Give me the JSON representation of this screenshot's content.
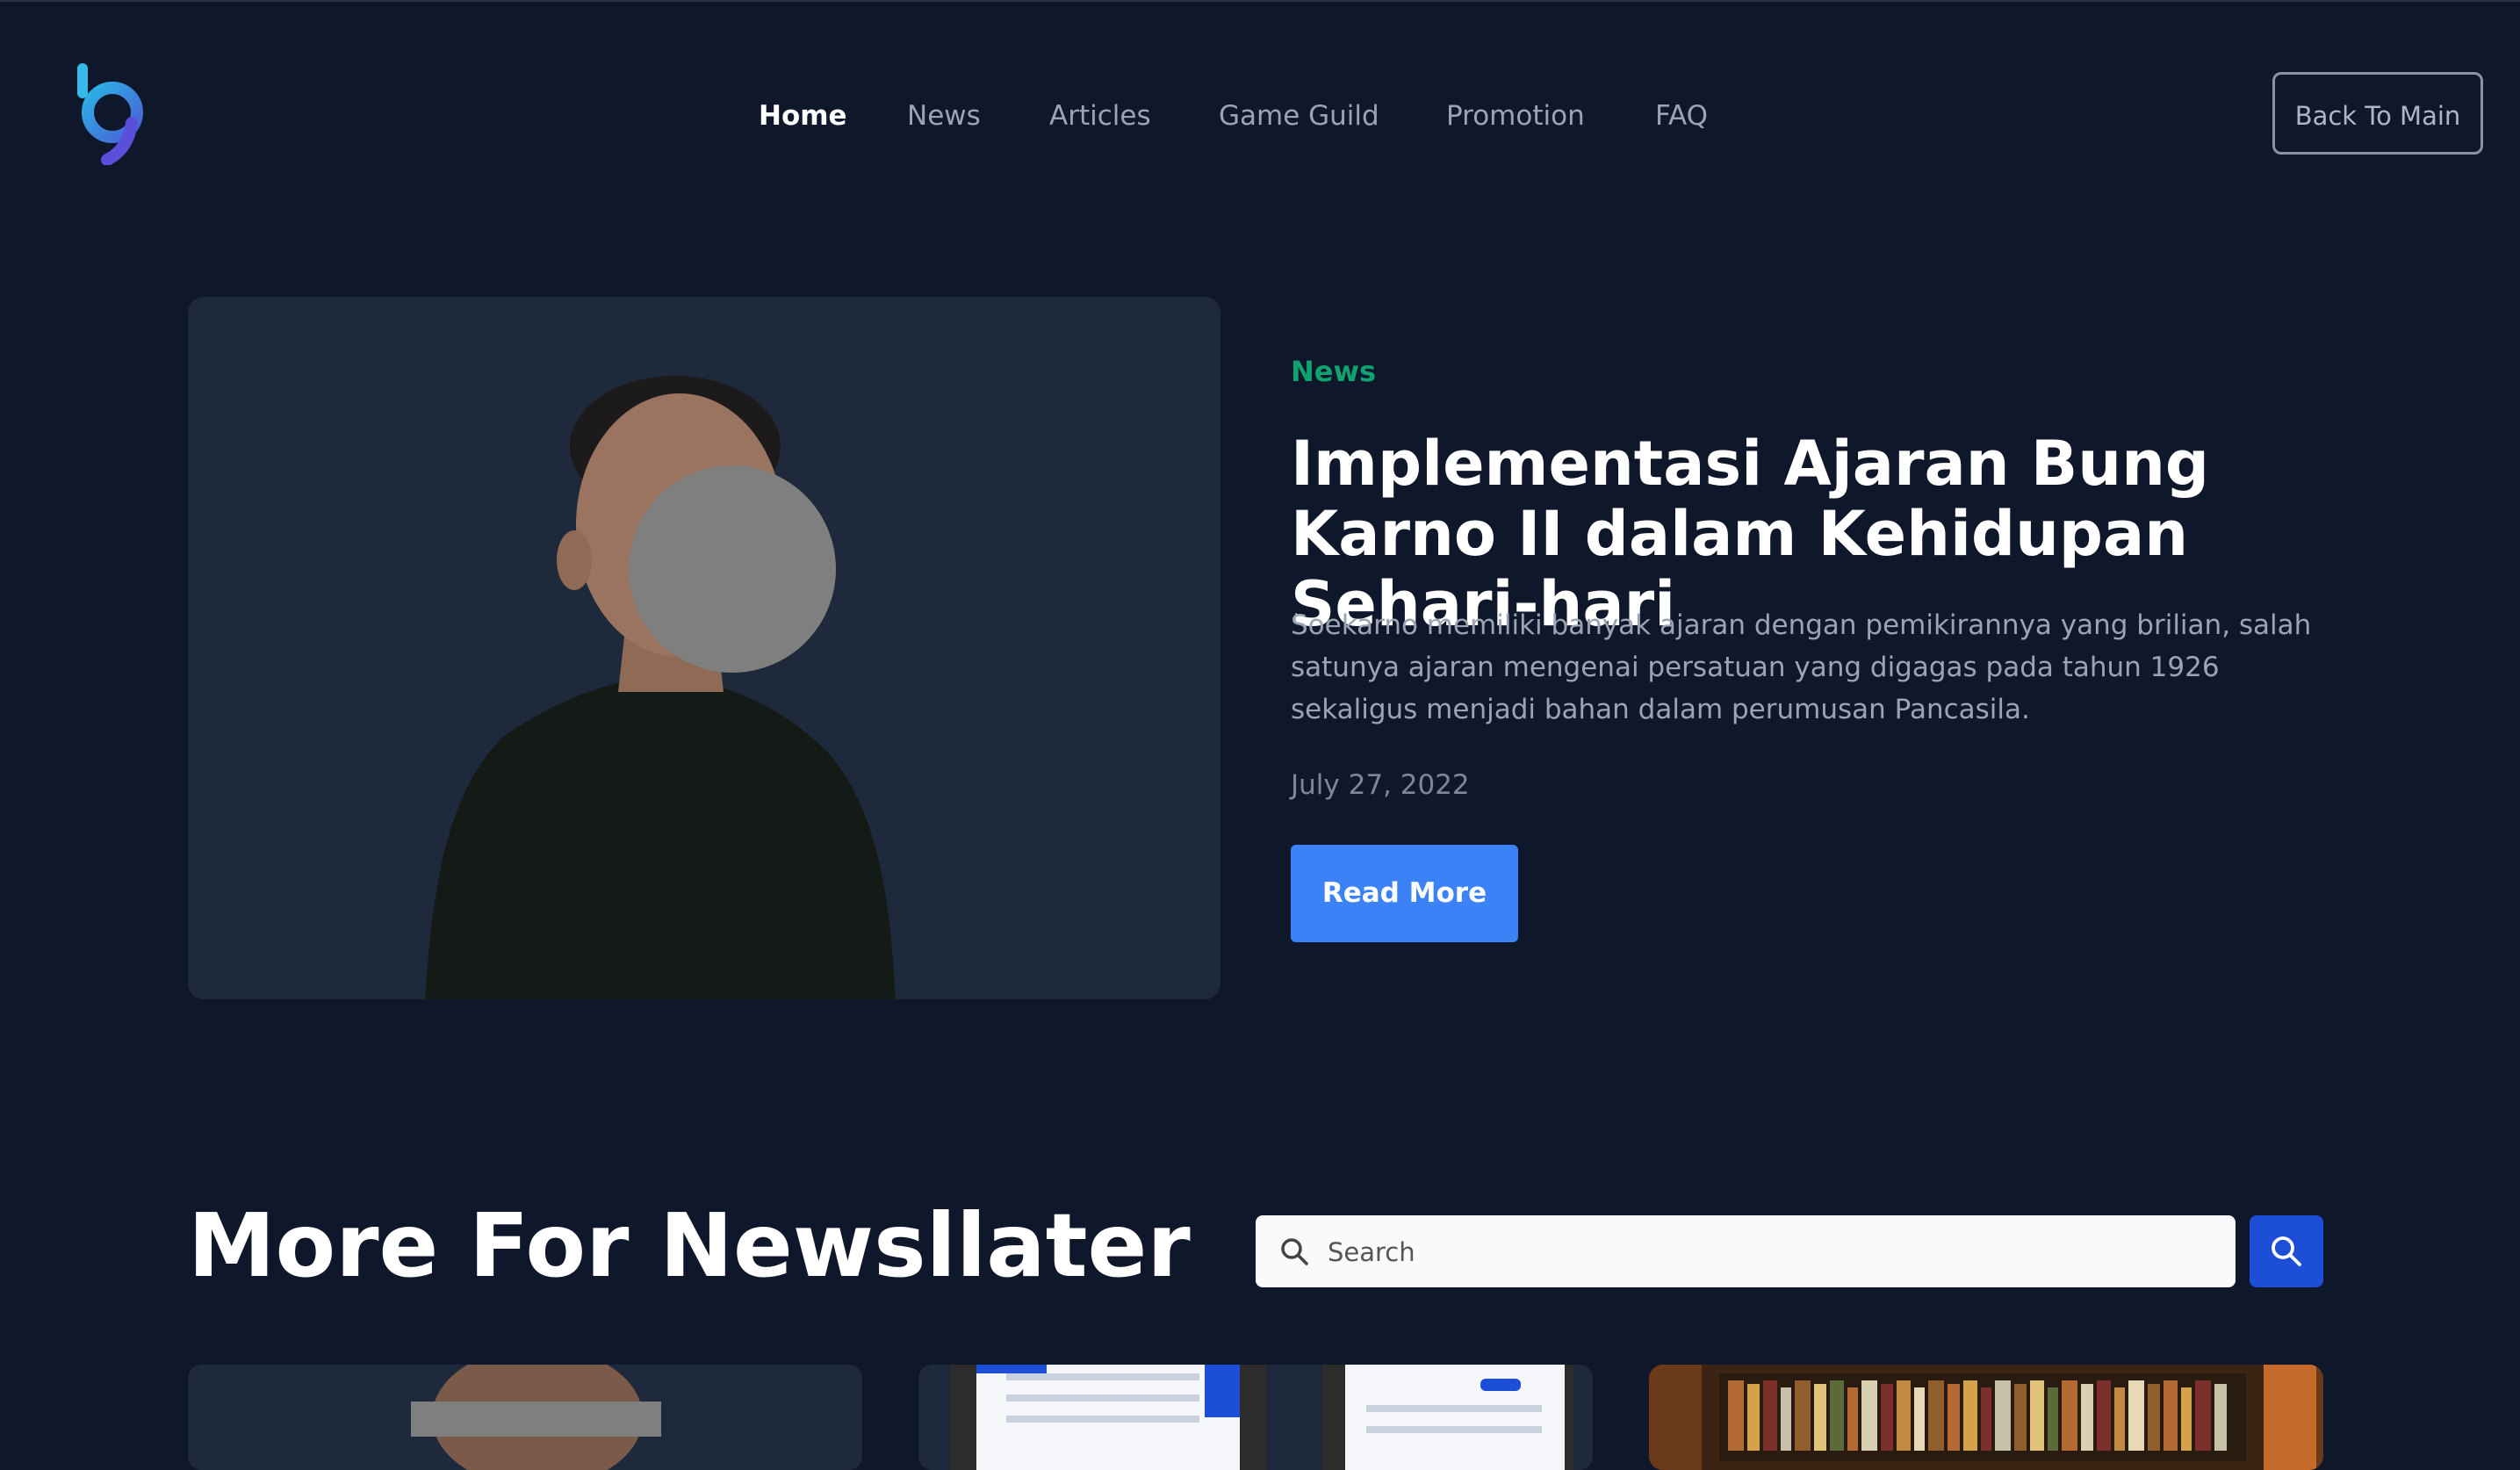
{
  "nav": {
    "items": [
      {
        "label": "Home",
        "active": true
      },
      {
        "label": "News",
        "active": false
      },
      {
        "label": "Articles",
        "active": false
      },
      {
        "label": "Game Guild",
        "active": false
      },
      {
        "label": "Promotion",
        "active": false
      },
      {
        "label": "FAQ",
        "active": false
      }
    ],
    "back_button": "Back To Main"
  },
  "hero": {
    "category": "News",
    "title": "Implementasi Ajaran Bung Karno II dalam Kehidupan Sehari-hari",
    "description": "Soekarno memiliki banyak ajaran dengan pemikirannya yang brilian, salah satunya ajaran mengenai persatuan yang digagas pada tahun 1926 sekaligus menjadi bahan dalam perumusan Pancasila.",
    "date": "July 27, 2022",
    "read_more": "Read More"
  },
  "more": {
    "title": "More For Newsllater",
    "search_placeholder": "Search"
  },
  "colors": {
    "background": "#0f172a",
    "card": "#1e293b",
    "accent_blue": "#3b82f6",
    "accent_green": "#10a36f"
  },
  "icons": {
    "logo": "brand-logo",
    "search": "search-icon"
  }
}
